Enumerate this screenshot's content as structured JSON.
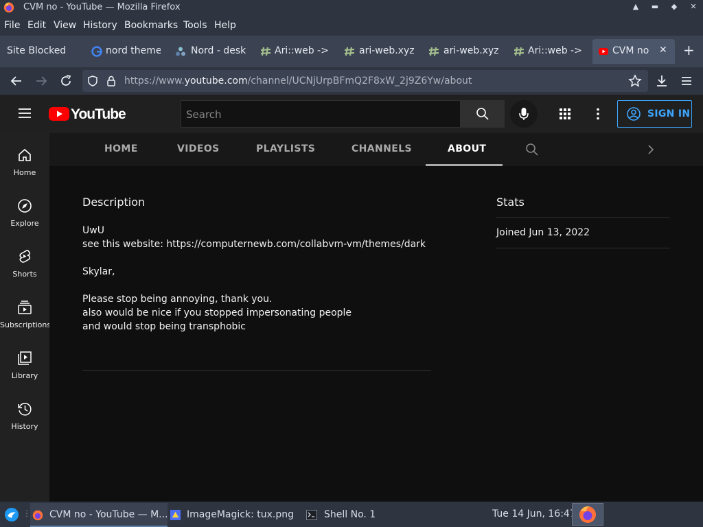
{
  "window": {
    "title": "CVM no - YouTube — Mozilla Firefox"
  },
  "menu": [
    "File",
    "Edit",
    "View",
    "History",
    "Bookmarks",
    "Tools",
    "Help"
  ],
  "tabs": [
    {
      "label": "Site Blocked",
      "icon": "none"
    },
    {
      "label": "nord theme",
      "icon": "google-icon"
    },
    {
      "label": "Nord - desk",
      "icon": "nord-icon"
    },
    {
      "label": "Ari::web ->",
      "icon": "hash-icon"
    },
    {
      "label": "ari-web.xyz",
      "icon": "hash-icon"
    },
    {
      "label": "ari-web.xyz",
      "icon": "hash-icon"
    },
    {
      "label": "Ari::web ->",
      "icon": "hash-icon"
    },
    {
      "label": "CVM no -",
      "icon": "youtube-icon",
      "active": true
    }
  ],
  "urlbar": {
    "prefix": "https://www.",
    "domain": "youtube.com",
    "path": "/channel/UCNjUrpBFmQ2F8xW_2j9Z6Yw/about"
  },
  "youtube": {
    "logo_text": "YouTube",
    "search_placeholder": "Search",
    "sign_in": "SIGN IN"
  },
  "guide": [
    {
      "label": "Home",
      "icon": "home-icon"
    },
    {
      "label": "Explore",
      "icon": "compass-icon"
    },
    {
      "label": "Shorts",
      "icon": "shorts-icon"
    },
    {
      "label": "Subscriptions",
      "icon": "subscriptions-icon"
    },
    {
      "label": "Library",
      "icon": "library-icon"
    },
    {
      "label": "History",
      "icon": "history-icon"
    }
  ],
  "channel_tabs": [
    "HOME",
    "VIDEOS",
    "PLAYLISTS",
    "CHANNELS",
    "ABOUT"
  ],
  "about": {
    "description_heading": "Description",
    "description_lines": [
      "UwU",
      "see this website: https://computernewb.com/collabvm-vm/themes/dark",
      "",
      "Skylar,",
      "",
      "Please stop being annoying, thank you.",
      "also would be nice if you stopped impersonating people",
      "and would stop being transphobic"
    ],
    "stats_heading": "Stats",
    "joined": "Joined Jun 13, 2022"
  },
  "taskbar": {
    "tasks": [
      {
        "label": "CVM no - YouTube — M...",
        "icon": "firefox-icon"
      },
      {
        "label": "ImageMagick: tux.png",
        "icon": "imagemagick-icon"
      },
      {
        "label": "Shell No. 1",
        "icon": "terminal-icon"
      }
    ],
    "clock": "Tue 14 Jun, 16:47"
  },
  "colors": {
    "accent": "#3ea6ff",
    "youtube_red": "#ff0000",
    "nord_bg": "#2e3440"
  }
}
